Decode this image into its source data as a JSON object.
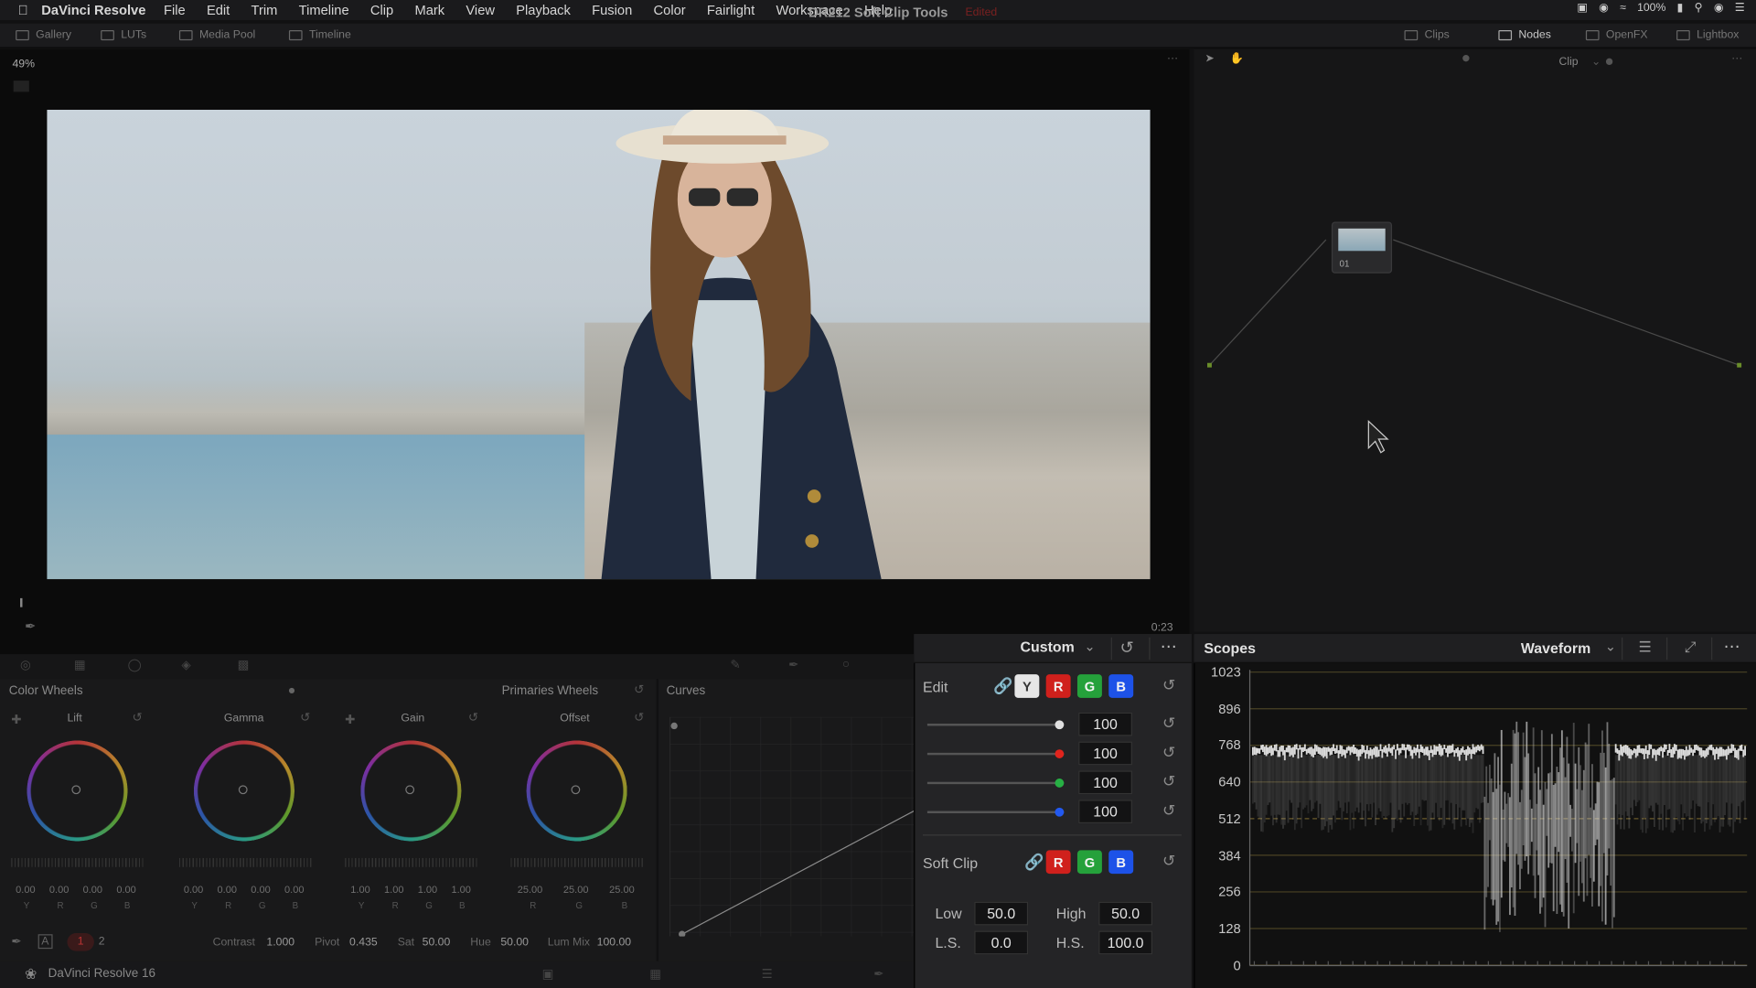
{
  "menubar": {
    "app_name": "DaVinci Resolve",
    "items": [
      "File",
      "Edit",
      "Trim",
      "Timeline",
      "Clip",
      "Mark",
      "View",
      "Playback",
      "Fusion",
      "Color",
      "Fairlight",
      "Workspace",
      "Help"
    ],
    "battery": "100%"
  },
  "pagebar": {
    "left": [
      "Gallery",
      "LUTs",
      "Media Pool",
      "Timeline"
    ],
    "project_title": "DR212 Soft Clip Tools",
    "project_state": "Edited",
    "right": [
      "Clips",
      "Nodes",
      "OpenFX",
      "Lightbox"
    ]
  },
  "viewer": {
    "zoom": "49%",
    "timecode": "0:23"
  },
  "nodes": {
    "mode": "Clip",
    "node_label": "01"
  },
  "color_wheels": {
    "title": "Color Wheels",
    "mode": "Primaries Wheels",
    "wheels": [
      {
        "name": "Lift",
        "values": [
          "0.00",
          "0.00",
          "0.00",
          "0.00"
        ],
        "channels": [
          "Y",
          "R",
          "G",
          "B"
        ]
      },
      {
        "name": "Gamma",
        "values": [
          "0.00",
          "0.00",
          "0.00",
          "0.00"
        ],
        "channels": [
          "Y",
          "R",
          "G",
          "B"
        ]
      },
      {
        "name": "Gain",
        "values": [
          "1.00",
          "1.00",
          "1.00",
          "1.00"
        ],
        "channels": [
          "Y",
          "R",
          "G",
          "B"
        ]
      },
      {
        "name": "Offset",
        "values": [
          "25.00",
          "25.00",
          "25.00"
        ],
        "channels": [
          "R",
          "G",
          "B"
        ]
      }
    ],
    "pages": [
      "1",
      "2"
    ],
    "params": {
      "contrast_label": "Contrast",
      "contrast": "1.000",
      "pivot_label": "Pivot",
      "pivot": "0.435",
      "sat_label": "Sat",
      "sat": "50.00",
      "hue_label": "Hue",
      "hue": "50.00",
      "lummix_label": "Lum Mix",
      "lummix": "100.00"
    }
  },
  "curves": {
    "title": "Curves"
  },
  "custom": {
    "mode": "Custom",
    "edit_label": "Edit",
    "channels": [
      "Y",
      "R",
      "G",
      "B"
    ],
    "edit_values": [
      {
        "channel": "Y",
        "value": "100",
        "level": 1.0,
        "color": "#e0e0e0"
      },
      {
        "channel": "R",
        "value": "100",
        "level": 1.0,
        "color": "#e0241d"
      },
      {
        "channel": "G",
        "value": "100",
        "level": 1.0,
        "color": "#27b044"
      },
      {
        "channel": "B",
        "value": "100",
        "level": 1.0,
        "color": "#2259f0"
      }
    ],
    "soft_clip_label": "Soft Clip",
    "soft_clip_channels": [
      "R",
      "G",
      "B"
    ],
    "low_label": "Low",
    "low": "50.0",
    "high_label": "High",
    "high": "50.0",
    "ls_label": "L.S.",
    "ls": "0.0",
    "hs_label": "H.S.",
    "hs": "100.0"
  },
  "scopes": {
    "title": "Scopes",
    "mode": "Waveform",
    "y_ticks": [
      "1023",
      "896",
      "768",
      "640",
      "512",
      "384",
      "256",
      "128",
      "0"
    ]
  },
  "statusbar": {
    "app": "DaVinci Resolve 16"
  }
}
